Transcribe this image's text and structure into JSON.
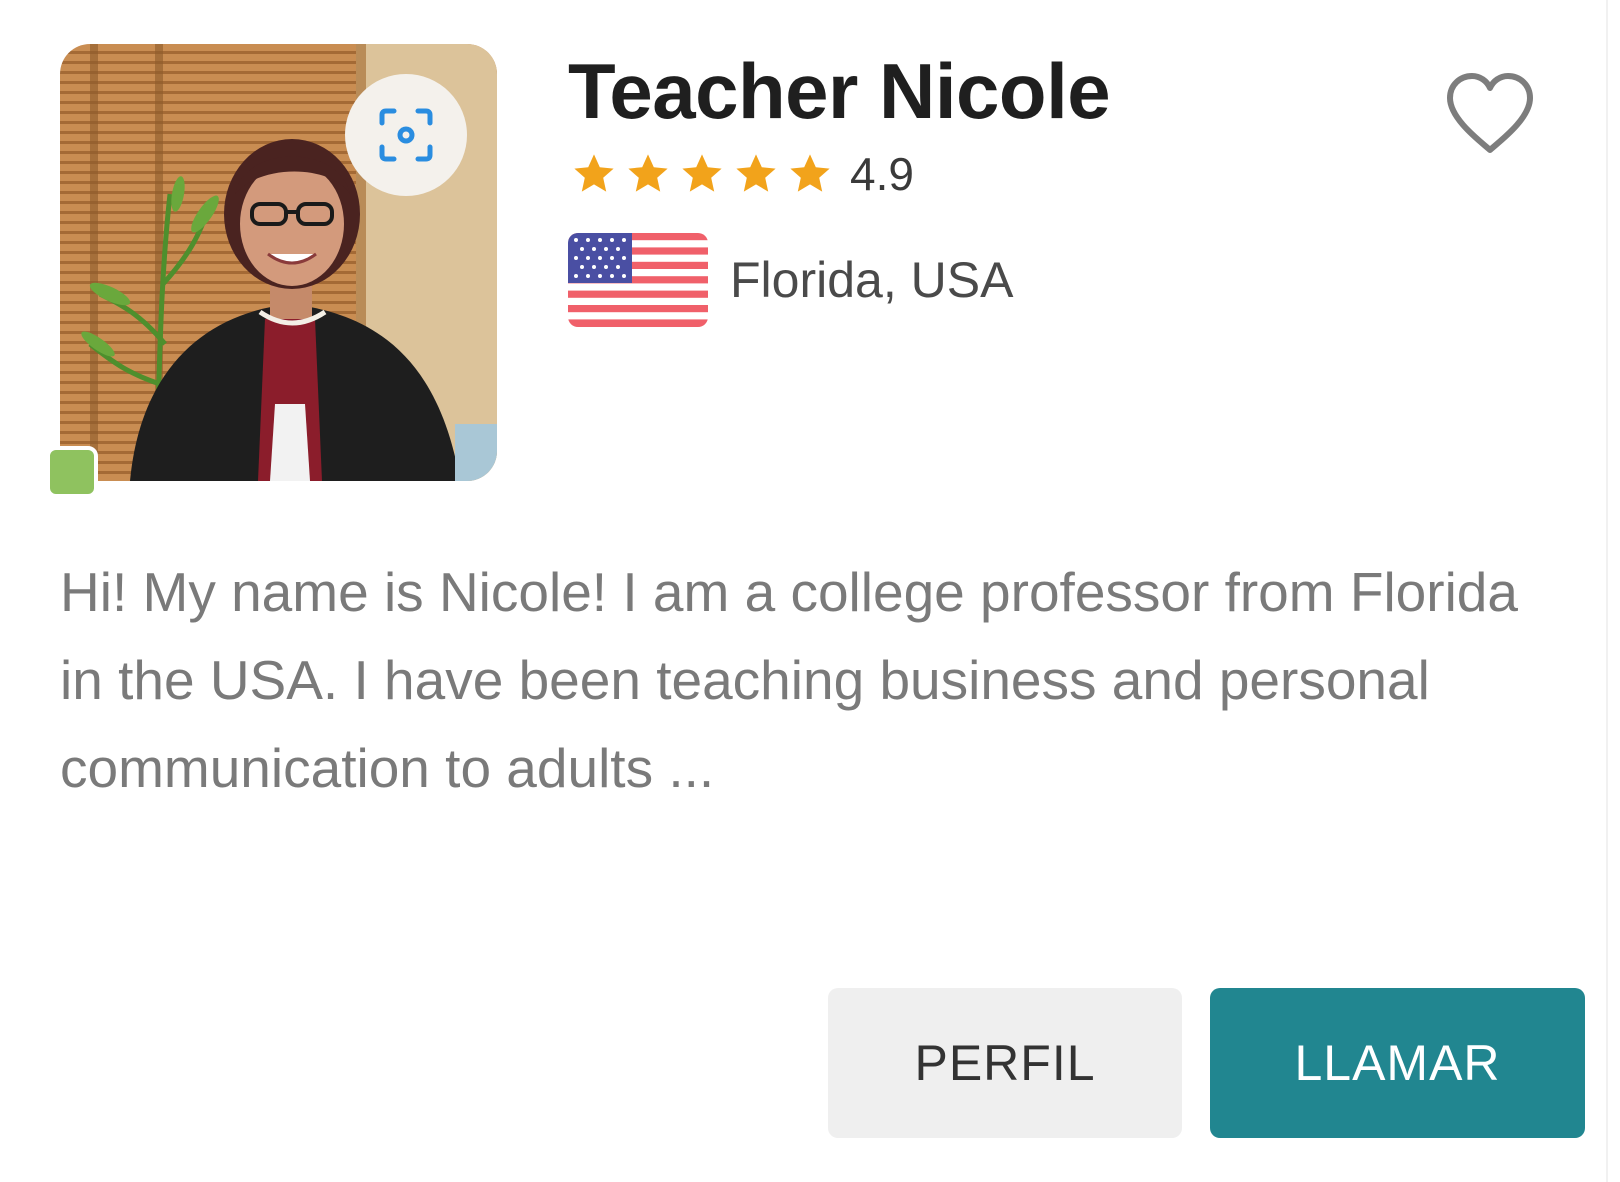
{
  "teacher": {
    "name": "Teacher Nicole",
    "rating": "4.9",
    "stars": 5,
    "location": "Florida, USA",
    "online": true,
    "bio": "Hi! My name is Nicole! I am a college professor from Florida in the USA. I have been teaching business and personal communication to adults ..."
  },
  "icons": {
    "scan": "scan-camera-icon",
    "favorite": "heart-outline-icon",
    "star": "star-icon",
    "flag": "us-flag-icon"
  },
  "actions": {
    "profile_label": "PERFIL",
    "call_label": "LLAMAR"
  },
  "colors": {
    "accent": "#218690",
    "star": "#f2a31b",
    "online": "#8fc25f",
    "scan_icon": "#2a8de0",
    "secondary_button": "#efefef"
  }
}
